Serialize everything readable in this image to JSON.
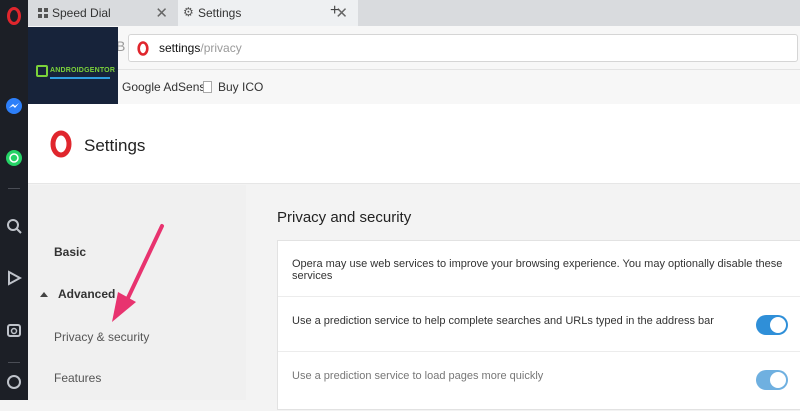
{
  "tabs": [
    {
      "label": "Speed Dial"
    },
    {
      "label": "Settings"
    }
  ],
  "address": {
    "host": "settings",
    "path": "/privacy"
  },
  "bookmarks": [
    {
      "label": "Google AdSense"
    },
    {
      "label": "Buy ICO"
    }
  ],
  "logo": {
    "text": "ANDROIDGENTOR"
  },
  "settings": {
    "title": "Settings",
    "nav": {
      "basic": "Basic",
      "advanced": "Advanced",
      "privacy": "Privacy & security",
      "features": "Features"
    },
    "section_title": "Privacy and security",
    "rows": [
      {
        "text": "Opera may use web services to improve your browsing experience. You may optionally disable these services"
      },
      {
        "text": "Use a prediction service to help complete searches and URLs typed in the address bar",
        "toggle": true
      },
      {
        "text": "Use a prediction service to load pages more quickly",
        "toggle": true
      }
    ]
  },
  "colors": {
    "opera_red": "#e0262d",
    "toggle_blue": "#2f8fd8",
    "arrow_pink": "#e8336f"
  }
}
